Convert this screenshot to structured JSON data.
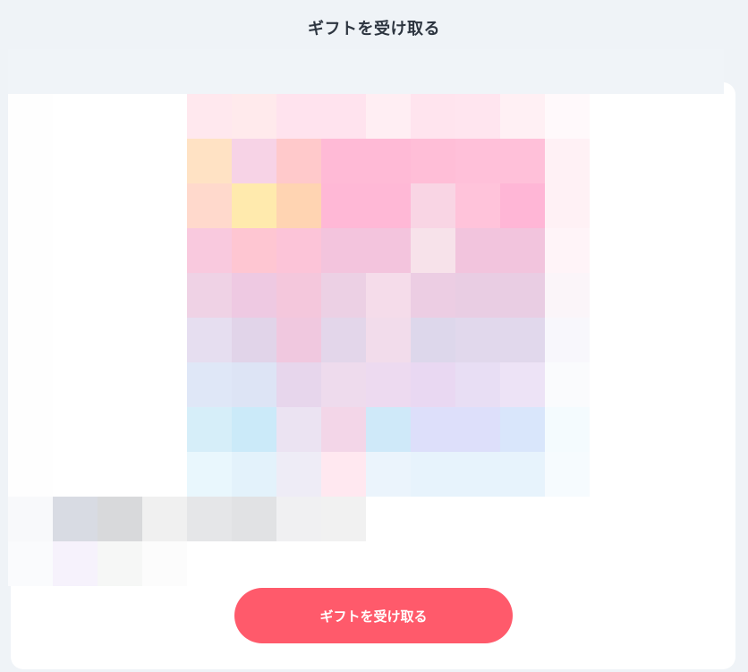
{
  "header": {
    "title": "ギフトを受け取る"
  },
  "gift": {
    "image_icon": "gift-card-image-mosaic",
    "mosaic_grid": {
      "cols": 13,
      "rows": 11,
      "colors": [
        [
          "#fefefe",
          "#ffffff",
          "#ffffff",
          "#ffffff",
          "#ffe8ee",
          "#ffeaec",
          "#ffe3ee",
          "#ffe3ee",
          "#ffeef3",
          "#ffe4ee",
          "#ffe5ef",
          "#fff0f4",
          "#fff9fb"
        ],
        [
          "#fefefe",
          "#ffffff",
          "#ffffff",
          "#ffffff",
          "#ffe2c4",
          "#f7d3e6",
          "#ffc9cb",
          "#ffbad6",
          "#ffbad6",
          "#ffbed7",
          "#ffc0d9",
          "#ffc0d9",
          "#fff1f5"
        ],
        [
          "#fefefe",
          "#ffffff",
          "#ffffff",
          "#ffffff",
          "#ffd9cc",
          "#ffeaad",
          "#ffd4b2",
          "#ffb8d6",
          "#ffb8d6",
          "#f9d5e4",
          "#ffc3da",
          "#ffb6d6",
          "#fff1f5"
        ],
        [
          "#fefefe",
          "#ffffff",
          "#ffffff",
          "#ffffff",
          "#f9c9de",
          "#fec6d2",
          "#fcc4d8",
          "#f3c4dd",
          "#f3c4dd",
          "#f7e2ea",
          "#f2c4dd",
          "#f2c4dd",
          "#fff4f8"
        ],
        [
          "#fefefe",
          "#ffffff",
          "#ffffff",
          "#ffffff",
          "#efd2e5",
          "#eec9e2",
          "#f4c7dc",
          "#ecd0e4",
          "#f5dcea",
          "#eccde3",
          "#e9cde3",
          "#e9cde3",
          "#fbf5f9"
        ],
        [
          "#fefefe",
          "#ffffff",
          "#ffffff",
          "#ffffff",
          "#e6def0",
          "#e1d4e9",
          "#f0c8df",
          "#e3d6ea",
          "#f2dceb",
          "#ddd7eb",
          "#e1d8ec",
          "#e1d8ec",
          "#f8f7fc"
        ],
        [
          "#fefefe",
          "#ffffff",
          "#ffffff",
          "#ffffff",
          "#dfe7f7",
          "#dde4f5",
          "#e7d6ec",
          "#eedbed",
          "#eddaf0",
          "#e9d8f2",
          "#e8def4",
          "#ede3f6",
          "#fafbfd"
        ],
        [
          "#fefefe",
          "#ffffff",
          "#ffffff",
          "#ffffff",
          "#d6eef9",
          "#cbeaf9",
          "#ebe3f2",
          "#f3d6e8",
          "#cfe9f9",
          "#dddffa",
          "#dddffa",
          "#d9e6fb",
          "#f4fbfe"
        ],
        [
          "#fefefe",
          "#ffffff",
          "#ffffff",
          "#ffffff",
          "#e9f7fd",
          "#e3f2fb",
          "#eeecf6",
          "#ffe8f0",
          "#ebf4fc",
          "#e7f3fc",
          "#e7f3fc",
          "#e7f3fc",
          "#f6fbfe"
        ],
        [
          "#f8f9fb",
          "#d8dbe3",
          "#d8d9db",
          "#f0f0f0",
          "#e5e6e8",
          "#e1e2e4",
          "#f0f0f2",
          "#f1f1f1",
          "#ffffff",
          "#ffffff",
          "#ffffff",
          "#ffffff",
          "#ffffff"
        ],
        [
          "#fafbfd",
          "#f6f2fc",
          "#f6f7f6",
          "#fcfcfc",
          "#ffffff",
          "#ffffff",
          "#ffffff",
          "#ffffff",
          "#ffffff",
          "#ffffff",
          "#ffffff",
          "#ffffff",
          "#ffffff"
        ]
      ]
    }
  },
  "actions": {
    "receive_label": "ギフトを受け取る",
    "button_color": "#ff5a6b"
  }
}
